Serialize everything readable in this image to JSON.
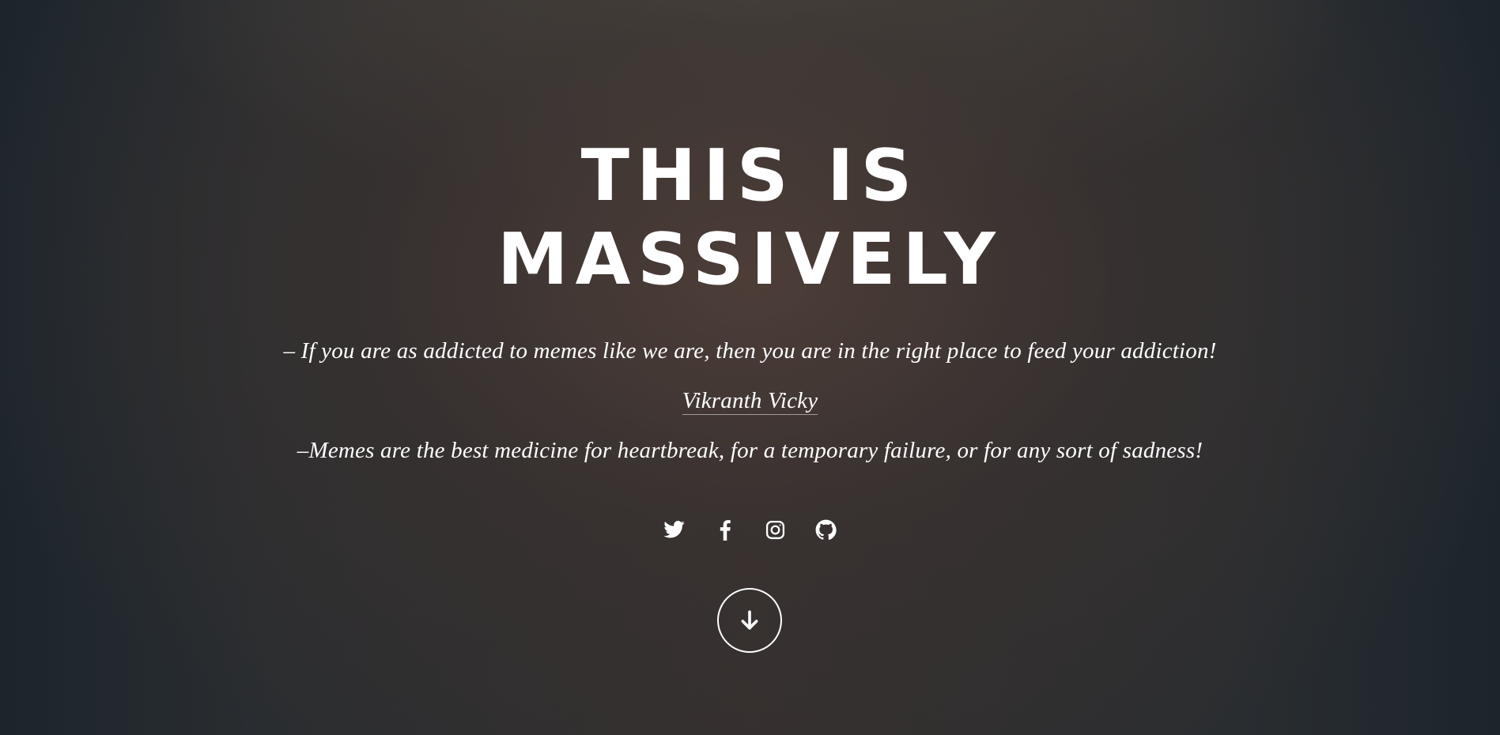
{
  "hero": {
    "title_line1": "THIS IS",
    "title_line2": "MASSIVELY",
    "quote1": "– If you are as addicted to memes like we are, then you are in the right place to feed your addiction!",
    "author": "Vikranth Vicky",
    "quote2": "–Memes are the best medicine for heartbreak, for a temporary failure, or for any sort of sadness!"
  },
  "social": [
    {
      "name": "twitter-icon"
    },
    {
      "name": "facebook-icon"
    },
    {
      "name": "instagram-icon"
    },
    {
      "name": "github-icon"
    }
  ],
  "scroll": {
    "icon": "arrow-down-icon"
  },
  "colors": {
    "text": "#ffffff",
    "background": "#2c2e30"
  }
}
